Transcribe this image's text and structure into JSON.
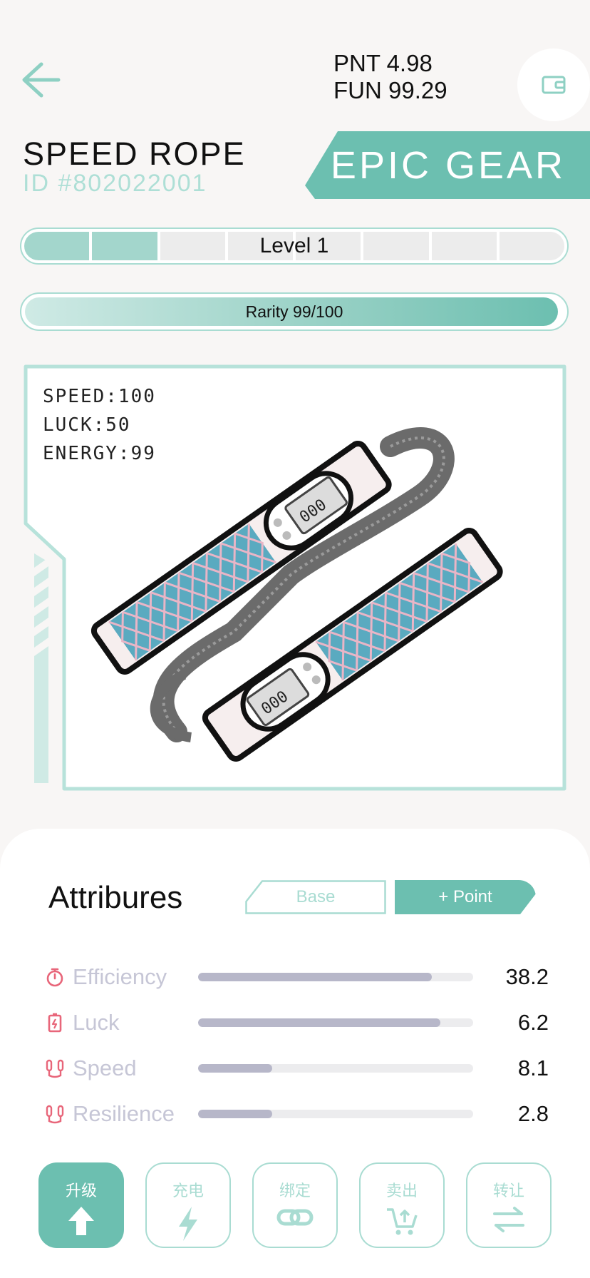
{
  "header": {
    "pnt": "PNT 4.98",
    "fun": "FUN 99.29"
  },
  "gear": {
    "name": "SPEED ROPE",
    "id": "ID #802022001",
    "quality": "EPIC GEAR",
    "level_label": "Level 1",
    "level_progress": 0.25,
    "rarity_label": "Rarity 99/100",
    "rarity": 0.99,
    "stats": [
      "SPEED:100",
      "LUCK:50",
      "ENERGY:99"
    ]
  },
  "attributes": {
    "title": "Attribures",
    "tabs": {
      "base": "Base",
      "point": "+ Point"
    },
    "rows": [
      {
        "name": "Efficiency",
        "value": "38.2",
        "fill": 0.85,
        "icon": "stopwatch-icon"
      },
      {
        "name": "Luck",
        "value": "6.2",
        "fill": 0.88,
        "icon": "battery-charge-icon"
      },
      {
        "name": "Speed",
        "value": "8.1",
        "fill": 0.27,
        "icon": "jump-rope-icon"
      },
      {
        "name": "Resilience",
        "value": "2.8",
        "fill": 0.27,
        "icon": "jump-rope-icon"
      }
    ]
  },
  "actions": [
    {
      "label": "升级",
      "icon": "arrow-up-icon"
    },
    {
      "label": "充电",
      "icon": "lightning-icon"
    },
    {
      "label": "绑定",
      "icon": "link-icon"
    },
    {
      "label": "卖出",
      "icon": "cart-icon"
    },
    {
      "label": "转让",
      "icon": "transfer-icon"
    }
  ],
  "colors": {
    "accent": "#6cbfb0",
    "accent_light": "#a9dcd2",
    "background": "#f8f6f5",
    "icon_red": "#e8667a"
  }
}
